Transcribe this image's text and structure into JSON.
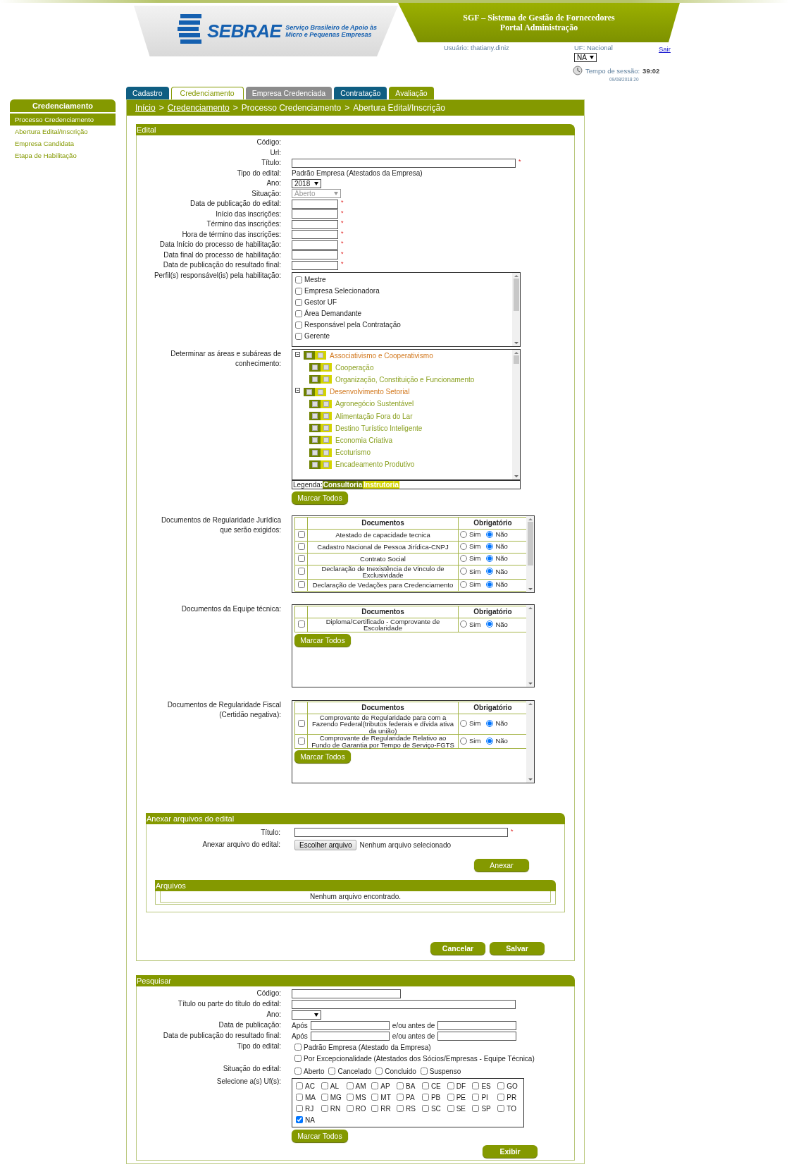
{
  "header": {
    "logo_text": "SEBRAE",
    "logo_tagline": [
      "Serviço Brasileiro de Apoio às",
      "Micro e Pequenas Empresas"
    ],
    "system_title": [
      "SGF – Sistema de Gestão de Fornecedores",
      "Portal Administração"
    ],
    "user_label": "Usuário: thatiany.diniz",
    "uf_label": "UF: Nacional",
    "uf_select": "NA",
    "logout": "Sair",
    "session_label": "Tempo de sessão:",
    "session_time": "39:02",
    "session_date": "09/08/2018 20"
  },
  "tabs": [
    {
      "label": "Cadastro",
      "selected": false,
      "color": "#0f5e82"
    },
    {
      "label": "Credenciamento",
      "selected": true,
      "color": "#849900"
    },
    {
      "label": "Empresa Credenciada",
      "selected": false,
      "color": "#8c8c8c"
    },
    {
      "label": "Contratação",
      "selected": false,
      "color": "#0f5e82"
    },
    {
      "label": "Avaliação",
      "selected": false,
      "color": "#849900"
    }
  ],
  "sidebar": {
    "title": "Credenciamento",
    "items": [
      {
        "label": "Processo Credenciamento",
        "selected": true
      },
      {
        "label": "Abertura Edital/Inscrição",
        "selected": false
      },
      {
        "label": "Empresa Candidata",
        "selected": false
      },
      {
        "label": "Etapa de Habilitação",
        "selected": false
      }
    ]
  },
  "breadcrumb": {
    "separator": ">",
    "items": [
      {
        "label": "Início",
        "link": true
      },
      {
        "label": "Credenciamento",
        "link": true
      },
      {
        "label": "Processo Credenciamento",
        "link": false
      },
      {
        "label": "Abertura Edital/Inscrição",
        "link": false
      }
    ]
  },
  "edital": {
    "title": "Edital",
    "fields": [
      {
        "label": "Código:",
        "kind": "text"
      },
      {
        "label": "Url:",
        "kind": "text"
      },
      {
        "label": "Título:",
        "kind": "long_input",
        "required_mark": "*"
      },
      {
        "label": "Tipo do edital:",
        "kind": "text",
        "value": "Padrão Empresa (Atestados da Empresa)"
      },
      {
        "label": "Ano:",
        "kind": "select",
        "value": "2018",
        "disabled": false
      },
      {
        "label": "Situação:",
        "kind": "select",
        "value": "Aberto",
        "disabled": true
      },
      {
        "label": "Data de publicação do edital:",
        "kind": "date_input",
        "required_mark": "*"
      },
      {
        "label": "Início das inscrições:",
        "kind": "date_input",
        "required_mark": "*"
      },
      {
        "label": "Término das inscrições:",
        "kind": "date_input",
        "required_mark": "*"
      },
      {
        "label": "Hora de término das inscrições:",
        "kind": "date_input",
        "required_mark": "*"
      },
      {
        "label": "Data Início do processo de habilitação:",
        "kind": "date_input",
        "required_mark": "*"
      },
      {
        "label": "Data final do processo de habilitação:",
        "kind": "date_input",
        "required_mark": "*"
      },
      {
        "label": "Data de publicação do resultado final:",
        "kind": "date_input",
        "required_mark": "*"
      },
      {
        "label": "Perfil(s) responsável(is) pela habilitação:",
        "kind": "checklist",
        "items": [
          {
            "label": "Mestre",
            "checked": false
          },
          {
            "label": "Empresa Selecionadora",
            "checked": false
          },
          {
            "label": "Gestor UF",
            "checked": false
          },
          {
            "label": "Área Demandante",
            "checked": false
          },
          {
            "label": "Responsável pela Contratação",
            "checked": false
          },
          {
            "label": "Gerente",
            "checked": false
          }
        ]
      },
      {
        "label": "Determinar as áreas e subáreas de conhecimento:",
        "kind": "tree",
        "nodes": [
          {
            "label": "Associativismo e Cooperativismo",
            "expanded": true,
            "children": [
              {
                "label": "Cooperação"
              },
              {
                "label": "Organização, Constituição e Funcionamento"
              }
            ]
          },
          {
            "label": "Desenvolvimento Setorial",
            "expanded": true,
            "children": [
              {
                "label": "Agronegócio Sustentável"
              },
              {
                "label": "Alimentação Fora do Lar"
              },
              {
                "label": "Destino Turístico Inteligente"
              },
              {
                "label": "Economia Criativa"
              },
              {
                "label": "Ecoturismo"
              },
              {
                "label": "Encadeamento Produtivo"
              }
            ]
          }
        ],
        "legend_label": "Legenda:",
        "legend": [
          {
            "label": "Consultoria",
            "color": "#6f8200"
          },
          {
            "label": "Instrutoria",
            "color": "#d4d400"
          }
        ],
        "button": "Marcar Todos"
      },
      {
        "label": "Documentos de Regularidade Jurídica que serão exigidos:",
        "kind": "doc_table",
        "columns": [
          "Documentos",
          "Obrigatório"
        ],
        "rows": [
          {
            "name": "Atestado de capacidade tecnica",
            "checked": false,
            "options": [
              {
                "label": "Sim",
                "selected": false
              },
              {
                "label": "Não",
                "selected": true
              }
            ]
          },
          {
            "name": "Cadastro Nacional de Pessoa Jirídica-CNPJ",
            "checked": false,
            "options": [
              {
                "label": "Sim",
                "selected": false
              },
              {
                "label": "Não",
                "selected": true
              }
            ]
          },
          {
            "name": "Contrato Social",
            "checked": false,
            "options": [
              {
                "label": "Sim",
                "selected": false
              },
              {
                "label": "Não",
                "selected": true
              }
            ]
          },
          {
            "name": "Declaração de Inexistência de Vinculo de Exclusividade",
            "checked": false,
            "options": [
              {
                "label": "Sim",
                "selected": false
              },
              {
                "label": "Não",
                "selected": true
              }
            ]
          },
          {
            "name": "Declaração de Vedações para Credenciamento",
            "checked": false,
            "options": [
              {
                "label": "Sim",
                "selected": false
              },
              {
                "label": "Não",
                "selected": true
              }
            ]
          }
        ]
      },
      {
        "label": "Documentos da Equipe técnica:",
        "kind": "doc_table",
        "columns": [
          "Documentos",
          "Obrigatório"
        ],
        "rows": [
          {
            "name": "Diploma/Certificado - Comprovante de Escolaridade",
            "checked": false,
            "options": [
              {
                "label": "Sim",
                "selected": false
              },
              {
                "label": "Não",
                "selected": true
              }
            ]
          }
        ],
        "button": "Marcar Todos"
      },
      {
        "label": "Documentos de Regularidade Fiscal (Certidão negativa):",
        "kind": "doc_table",
        "columns": [
          "Documentos",
          "Obrigatório"
        ],
        "rows": [
          {
            "name": "Comprovante de Regularidade para com a Fazendo Federal(tributos federais e dívida ativa da união)",
            "checked": false,
            "options": [
              {
                "label": "Sim",
                "selected": false
              },
              {
                "label": "Não",
                "selected": true
              }
            ]
          },
          {
            "name": "Comprovante de Regularidade Relativo ao Fundo de Garantia por Tempo de Serviço-FGTS",
            "checked": false,
            "options": [
              {
                "label": "Sim",
                "selected": false
              },
              {
                "label": "Não",
                "selected": true
              }
            ]
          }
        ],
        "button": "Marcar Todos"
      }
    ],
    "attach": {
      "title": "Anexar arquivos do edital",
      "title_label": "Título:",
      "required_mark": "*",
      "file_label": "Anexar arquivo do edital:",
      "file_button": "Escolher arquivo",
      "file_status": "Nenhum arquivo selecionado",
      "attach_button": "Anexar",
      "files_title": "Arquivos",
      "files_empty": "Nenhum arquivo encontrado."
    },
    "buttons": [
      "Cancelar",
      "Salvar"
    ]
  },
  "search": {
    "title": "Pesquisar",
    "fields": [
      {
        "label": "Código:",
        "kind": "medium_input"
      },
      {
        "label": "Título ou parte do título do edital:",
        "kind": "long_input"
      },
      {
        "label": "Ano:",
        "kind": "select",
        "disabled": false
      },
      {
        "label": "Data de publicação:",
        "kind": "date_range",
        "after": "Após",
        "before": "e/ou antes de"
      },
      {
        "label": "Data de publicação do resultado final:",
        "kind": "date_range",
        "after": "Após",
        "before": "e/ou antes de"
      },
      {
        "label": "Tipo do edital:",
        "kind": "check_column",
        "items": [
          {
            "label": "Padrão Empresa (Atestado da Empresa)",
            "checked": false
          },
          {
            "label": "Por Excepcionalidade (Atestados dos Sócios/Empresas - Equipe Técnica)",
            "checked": false
          }
        ]
      },
      {
        "label": "Situação do edital:",
        "kind": "check_row",
        "items": [
          {
            "label": "Aberto",
            "checked": false
          },
          {
            "label": "Cancelado",
            "checked": false
          },
          {
            "label": "Concluido",
            "checked": false
          },
          {
            "label": "Suspenso",
            "checked": false
          }
        ]
      },
      {
        "label": "Selecione a(s) Uf(s):",
        "kind": "check_grid",
        "items": [
          {
            "label": "AC",
            "checked": false
          },
          {
            "label": "AL",
            "checked": false
          },
          {
            "label": "AM",
            "checked": false
          },
          {
            "label": "AP",
            "checked": false
          },
          {
            "label": "BA",
            "checked": false
          },
          {
            "label": "CE",
            "checked": false
          },
          {
            "label": "DF",
            "checked": false
          },
          {
            "label": "ES",
            "checked": false
          },
          {
            "label": "GO",
            "checked": false
          },
          {
            "label": "MA",
            "checked": false
          },
          {
            "label": "MG",
            "checked": false
          },
          {
            "label": "MS",
            "checked": false
          },
          {
            "label": "MT",
            "checked": false
          },
          {
            "label": "PA",
            "checked": false
          },
          {
            "label": "PB",
            "checked": false
          },
          {
            "label": "PE",
            "checked": false
          },
          {
            "label": "PI",
            "checked": false
          },
          {
            "label": "PR",
            "checked": false
          },
          {
            "label": "RJ",
            "checked": false
          },
          {
            "label": "RN",
            "checked": false
          },
          {
            "label": "RO",
            "checked": false
          },
          {
            "label": "RR",
            "checked": false
          },
          {
            "label": "RS",
            "checked": false
          },
          {
            "label": "SC",
            "checked": false
          },
          {
            "label": "SE",
            "checked": false
          },
          {
            "label": "SP",
            "checked": false
          },
          {
            "label": "TO",
            "checked": false
          },
          {
            "label": "NA",
            "checked": true
          }
        ],
        "button": "Marcar Todos"
      }
    ],
    "button": "Exibir"
  }
}
